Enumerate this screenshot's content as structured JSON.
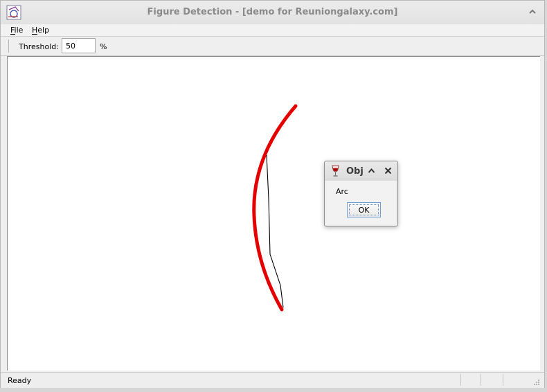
{
  "window": {
    "title": "Figure Detection - [demo for Reuniongalaxy.com]",
    "icon": "figure-detection-app-icon"
  },
  "menu": [
    {
      "label": "File",
      "mnemonic": "F"
    },
    {
      "label": "Help",
      "mnemonic": "H"
    }
  ],
  "toolbar": {
    "threshold_label": "Threshold:",
    "threshold_value": "50",
    "threshold_unit": "%"
  },
  "canvas": {
    "detected_stroke_color": "#e50000",
    "source_stroke_color": "#000000"
  },
  "status": {
    "text": "Ready"
  },
  "dialog": {
    "title": "Obj",
    "icon": "wine-glass-icon",
    "message": "Arc",
    "ok_label": "OK"
  }
}
